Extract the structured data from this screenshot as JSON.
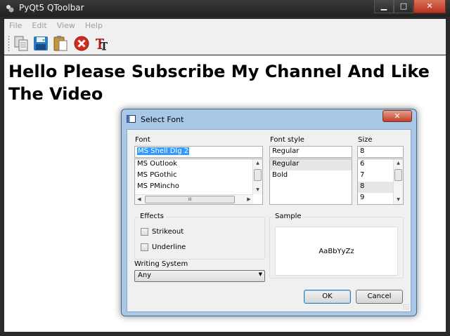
{
  "window": {
    "title": "PyQt5 QToolbar"
  },
  "menubar": {
    "items": [
      "File",
      "Edit",
      "View",
      "Help"
    ]
  },
  "toolbar": {
    "buttons": [
      "copy-icon",
      "save-icon",
      "paste-icon",
      "cancel-icon",
      "font-icon"
    ]
  },
  "central": {
    "text": "Hello Please Subscribe My Channel And Like The Video"
  },
  "font_dialog": {
    "title": "Select Font",
    "close_label": "✕",
    "font_label": "Font",
    "font_value": "MS Shell Dlg 2",
    "font_list": [
      "MS Outlook",
      "MS PGothic",
      "MS PMincho"
    ],
    "hscroll_thumb": "III",
    "style_label": "Font style",
    "style_value": "Regular",
    "style_list": [
      "Regular",
      "Bold"
    ],
    "size_label": "Size",
    "size_value": "8",
    "size_list": [
      "6",
      "7",
      "8",
      "9"
    ],
    "effects_label": "Effects",
    "strikeout_label": "Strikeout",
    "underline_label": "Underline",
    "sample_label": "Sample",
    "sample_text": "AaBbYyZz",
    "writing_system_label": "Writing System",
    "writing_system_value": "Any",
    "ok_label": "OK",
    "cancel_label": "Cancel"
  }
}
